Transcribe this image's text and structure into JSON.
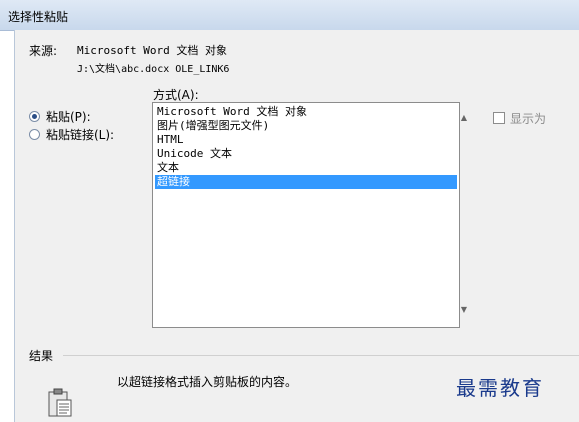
{
  "window": {
    "title": "选择性粘贴"
  },
  "source": {
    "label": "来源:",
    "name": "Microsoft Word 文档 对象",
    "path": "J:\\文档\\abc.docx OLE_LINK6"
  },
  "options": {
    "paste_label": "粘贴(P):",
    "paste_link_label": "粘贴链接(L):",
    "selected": "paste"
  },
  "as": {
    "label": "方式(A):",
    "items": [
      "Microsoft Word 文档 对象",
      "图片(增强型图元文件)",
      "HTML",
      "Unicode 文本",
      "文本",
      "超链接"
    ],
    "selected_index": 5
  },
  "display_as_icon": {
    "label": "显示为",
    "checked": false
  },
  "result": {
    "label": "结果",
    "description": "以超链接格式插入剪贴板的内容。"
  },
  "watermark": "最需教育"
}
